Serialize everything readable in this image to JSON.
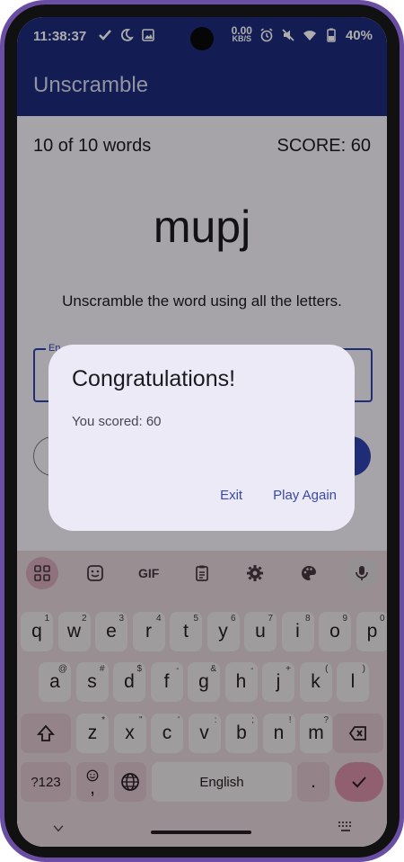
{
  "status_bar": {
    "time": "11:38:37",
    "net_speed_value": "0.00",
    "net_speed_unit": "KB/S",
    "battery": "40%",
    "icons": [
      "check-icon",
      "moon-icon",
      "image-icon",
      "alarm-icon",
      "mute-icon",
      "wifi-icon",
      "battery-icon"
    ]
  },
  "app_bar": {
    "title": "Unscramble"
  },
  "game": {
    "word_count": "10 of 10 words",
    "score": "SCORE: 60",
    "scrambled_word": "mupj",
    "instructions": "Unscramble the word using all the letters.",
    "field_label": "En"
  },
  "dialog": {
    "title": "Congratulations!",
    "body": "You scored: 60",
    "exit_label": "Exit",
    "play_again_label": "Play Again"
  },
  "keyboard": {
    "toolbar": [
      "apps-icon",
      "sticker-icon",
      "gif-icon",
      "clipboard-icon",
      "settings-icon",
      "palette-icon",
      "mic-icon"
    ],
    "gif_label": "GIF",
    "row1": [
      {
        "k": "q",
        "s": "1"
      },
      {
        "k": "w",
        "s": "2"
      },
      {
        "k": "e",
        "s": "3"
      },
      {
        "k": "r",
        "s": "4"
      },
      {
        "k": "t",
        "s": "5"
      },
      {
        "k": "y",
        "s": "6"
      },
      {
        "k": "u",
        "s": "7"
      },
      {
        "k": "i",
        "s": "8"
      },
      {
        "k": "o",
        "s": "9"
      },
      {
        "k": "p",
        "s": "0"
      }
    ],
    "row2": [
      {
        "k": "a",
        "s": "@"
      },
      {
        "k": "s",
        "s": "#"
      },
      {
        "k": "d",
        "s": "$"
      },
      {
        "k": "f",
        "s": "-"
      },
      {
        "k": "g",
        "s": "&"
      },
      {
        "k": "h",
        "s": "-"
      },
      {
        "k": "j",
        "s": "+"
      },
      {
        "k": "k",
        "s": "("
      },
      {
        "k": "l",
        "s": ")"
      }
    ],
    "row3": [
      {
        "k": "z",
        "s": "*"
      },
      {
        "k": "x",
        "s": "\""
      },
      {
        "k": "c",
        "s": "'"
      },
      {
        "k": "v",
        "s": ":"
      },
      {
        "k": "b",
        "s": ";"
      },
      {
        "k": "n",
        "s": "!"
      },
      {
        "k": "m",
        "s": "?"
      }
    ],
    "symbols_key": "?123",
    "comma_key": ",",
    "space_label": "English",
    "period_key": "."
  },
  "colors": {
    "app_bar": "#1d2c7c",
    "accent": "#3949ab",
    "keyboard_bg": "#f6e3ea",
    "enter_key": "#e79bb6"
  }
}
